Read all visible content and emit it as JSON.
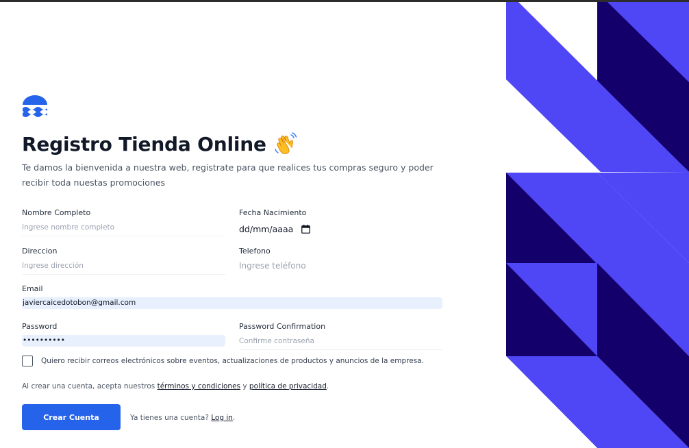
{
  "brand": {
    "logo_icon": "waves-logo-icon",
    "color": "#2563eb"
  },
  "header": {
    "title": "Registro Tienda Online",
    "title_emoji_icon": "waving-hand-icon",
    "subtitle": "Te damos la bienvenida a nuestra web, registrate para que realices tus compras seguro y poder recibir toda nuestas promociones"
  },
  "form": {
    "nombre": {
      "label": "Nombre Completo",
      "placeholder": "Ingrese nombre completo"
    },
    "fecha": {
      "label": "Fecha Nacimiento",
      "value": "dd/mm/aaaa",
      "icon": "calendar-icon"
    },
    "direccion": {
      "label": "Direccion",
      "placeholder": "Ingrese dirección"
    },
    "telefono": {
      "label": "Telefono",
      "placeholder": "Ingrese teléfono"
    },
    "email": {
      "label": "Email",
      "value": "javiercaicedotobon@gmail.com"
    },
    "password": {
      "label": "Password",
      "value": "••••••••••"
    },
    "password_confirmation": {
      "label": "Password Confirmation",
      "placeholder": "Confirme contraseña"
    },
    "marketing_opt_in": {
      "label": "Quiero recibir correos electrónicos sobre eventos, actualizaciones de productos y anuncios de la empresa.",
      "checked": false
    }
  },
  "terms": {
    "prefix": "Al crear una cuenta, acepta nuestros ",
    "terms_link": "términos y condiciones",
    "middle": " y ",
    "privacy_link": "política de privacidad",
    "suffix": "."
  },
  "actions": {
    "submit_label": "Crear Cuenta",
    "login_prompt": "Ya tienes una cuenta? ",
    "login_link": "Log in",
    "login_suffix": "."
  },
  "colors": {
    "accent": "#2563eb",
    "pattern_light": "#4f46f5",
    "pattern_dark": "#14006b",
    "autofill": "#e8f0fe"
  }
}
